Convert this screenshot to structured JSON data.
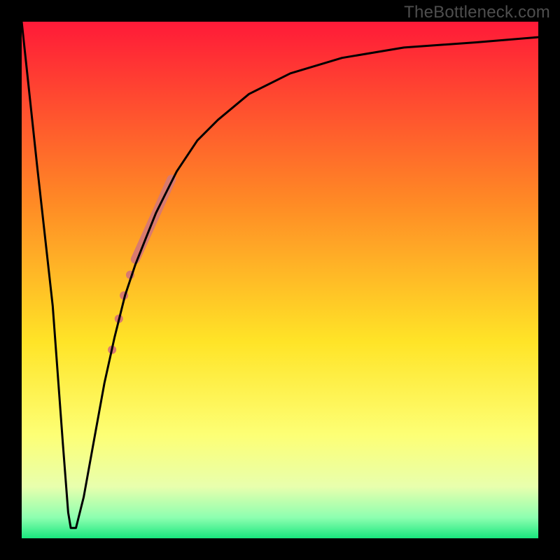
{
  "watermark": "TheBottleneck.com",
  "chart_data": {
    "type": "line",
    "title": "",
    "xlabel": "",
    "ylabel": "",
    "xlim": [
      0,
      100
    ],
    "ylim": [
      0,
      100
    ],
    "gradient_stops": [
      {
        "pct": 0,
        "color": "#ff1a38"
      },
      {
        "pct": 35,
        "color": "#ff8a25"
      },
      {
        "pct": 62,
        "color": "#ffe427"
      },
      {
        "pct": 80,
        "color": "#fdff75"
      },
      {
        "pct": 90,
        "color": "#e8ffad"
      },
      {
        "pct": 96,
        "color": "#8dffb0"
      },
      {
        "pct": 100,
        "color": "#19e77e"
      }
    ],
    "series": [
      {
        "name": "bottleneck-curve",
        "x": [
          0,
          3,
          6,
          8,
          9,
          9.5,
          10,
          10.5,
          11,
          12,
          14,
          16,
          18,
          20,
          22,
          24,
          26,
          28,
          30,
          34,
          38,
          44,
          52,
          62,
          74,
          88,
          100
        ],
        "y": [
          100,
          72,
          45,
          18,
          5,
          2,
          2,
          2,
          4,
          8,
          19,
          30,
          39,
          47,
          53,
          58,
          63,
          67,
          71,
          77,
          81,
          86,
          90,
          93,
          95,
          96,
          97
        ]
      }
    ],
    "markers": {
      "name": "highlight-segment",
      "color": "#d87a6f",
      "bar": {
        "x1": 22.0,
        "y1": 54.0,
        "x2": 29.0,
        "y2": 69.5,
        "width": 13
      },
      "dots": [
        {
          "x": 21.0,
          "y": 51.0,
          "r": 6
        },
        {
          "x": 19.8,
          "y": 47.0,
          "r": 6
        },
        {
          "x": 18.8,
          "y": 42.5,
          "r": 6
        },
        {
          "x": 17.5,
          "y": 36.5,
          "r": 6
        }
      ]
    }
  }
}
